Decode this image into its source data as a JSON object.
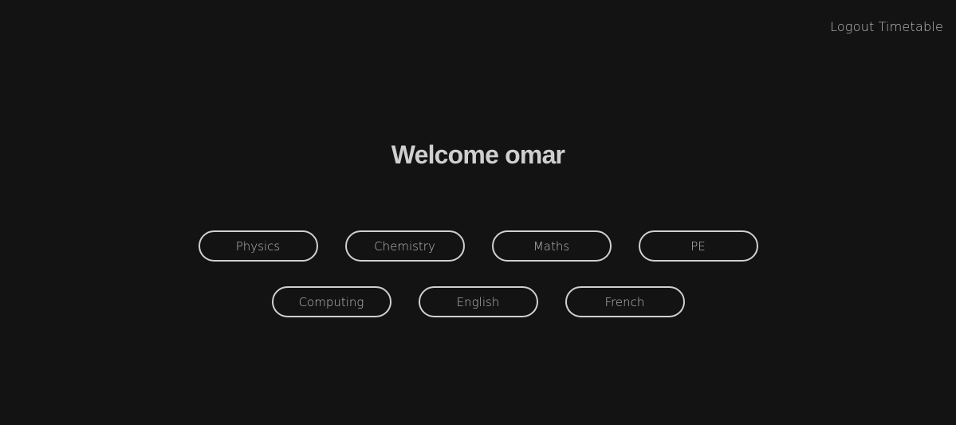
{
  "nav": {
    "logout": "Logout",
    "timetable": "Timetable"
  },
  "welcome": "Welcome omar",
  "subjects": {
    "row1": [
      "Physics",
      "Chemistry",
      "Maths",
      "PE"
    ],
    "row2": [
      "Computing",
      "English",
      "French"
    ]
  },
  "colors": {
    "background": "#131313",
    "text": "#bdbdbd",
    "border": "#d0d0d0"
  }
}
